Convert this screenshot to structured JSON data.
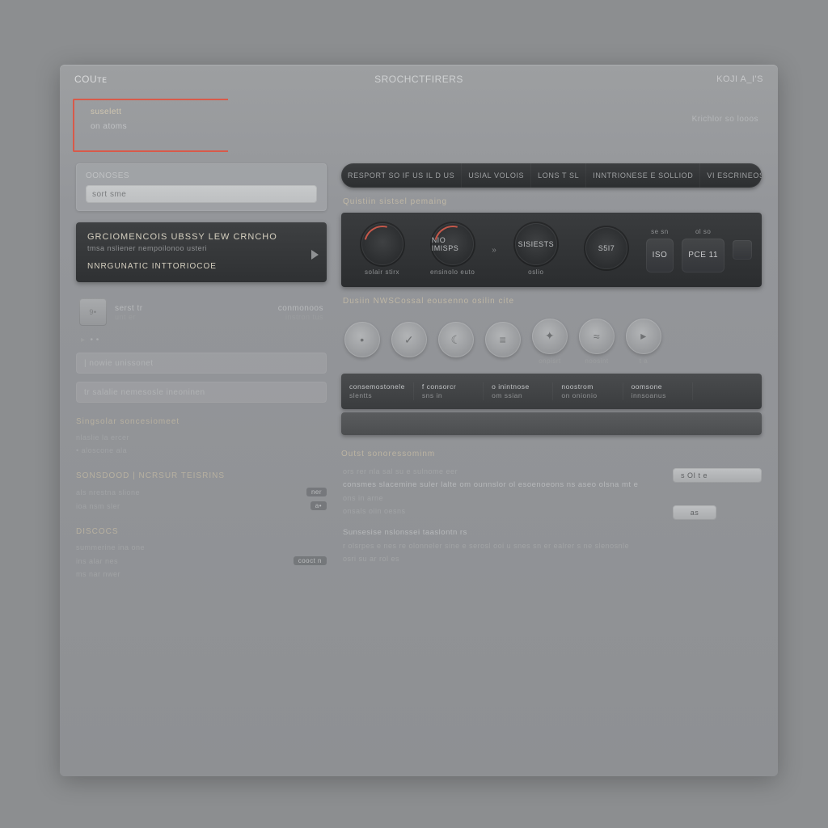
{
  "header": {
    "brand": "COUᴛᴇ",
    "title": "SROCHCTFIRERS",
    "account": "KOJI A_I'S"
  },
  "selection": {
    "line1": "suselett",
    "line2": "on atoms",
    "right_label": "Krichlor so looos"
  },
  "sidebar": {
    "card_title": "oonoses",
    "search_value": "sort sme",
    "feature": {
      "title": "GRCIOMENCOIS UBSSY LEW CRNCHO",
      "subtitle": "tmsa nsliener nempoilonoo usteri",
      "footer": "NNRGUNATIC INTTORIOCOE"
    },
    "items": [
      {
        "id": "a",
        "label": "serst tr",
        "sub": "unt er",
        "thumb": "9•"
      },
      {
        "id": "b",
        "label": "conmonoos",
        "sub": "instron tus",
        "thumb": ""
      }
    ],
    "arrow_marker": "• •",
    "row1": "| nowie unissonet",
    "row2": "tr salalie nemesosle ineoninen",
    "sections": [
      {
        "heading": "Singsolar soncesiomeet",
        "rows": [
          {
            "l": "nlaslie la ercer",
            "r": ""
          },
          {
            "l": "• aloscone ala",
            "r": ""
          }
        ]
      },
      {
        "heading": "SONSDOOD | NCRSUR TEISRINS",
        "rows": [
          {
            "l": "als nrestna slione",
            "r": "ner"
          },
          {
            "l": "ioa nsm sler",
            "r": "a•"
          }
        ]
      },
      {
        "heading": "DISCOCS",
        "rows": [
          {
            "l": "summerine ina one",
            "r": ""
          },
          {
            "l": "ins alar nes",
            "r": "cooct n"
          },
          {
            "l": "ms nar  nwer",
            "r": ""
          }
        ]
      }
    ]
  },
  "main": {
    "tabs": [
      "RESPORT SO  IF US IL D US",
      "USIAL  VOLOIS",
      "LONS T SL",
      "INNTRIONESE  E SOLLIOD",
      "VI ESCRINEOS"
    ],
    "dials_title": "Quistiin sistsel pemaing",
    "dials": [
      {
        "value": "",
        "caption": "solair stirx",
        "accent": true
      },
      {
        "value": "NIO IMISPS",
        "caption": "ensinolo euto",
        "accent": true
      },
      {
        "value": "SISIESTS",
        "caption": "oslio",
        "accent": false
      },
      {
        "value": "S5I7",
        "caption": "",
        "accent": false
      }
    ],
    "dial_pills": [
      {
        "top": "se sn",
        "value": "ISO"
      },
      {
        "top": "ol so",
        "value": "PCE 11"
      }
    ],
    "circles_title": "Dusiin NWSCossal eousenno osilin cite",
    "circles": [
      "•",
      "✓",
      "☾",
      "≡",
      "✦",
      "≈",
      "▸"
    ],
    "circle_labels": [
      "",
      "",
      "",
      "",
      "onpisrt",
      "noosint",
      "t a"
    ],
    "table_head": [
      {
        "t": "consemostonele",
        "s": "slentts"
      },
      {
        "t": "f consorcr",
        "s": "sns in"
      },
      {
        "t": "o inintnose",
        "s": "om ssian"
      },
      {
        "t": "noostrom",
        "s": "on onionio"
      },
      {
        "t": "oomsone",
        "s": "innsoanus"
      },
      {
        "t": "",
        "s": ""
      }
    ],
    "details_title": "Outst sonoressominm",
    "detail_lines": [
      "ors rer nla sal su e sulnome eer",
      "consmes slacemine suler lalte om ounnslor ol esoenoeons ns aseo olsna mt e",
      "ons in arne",
      "onsals oiin oesns",
      "Sunsesise nslonssei taaslontn rs",
      "r olsrpes e nes re olonneler sine e serosl ooi u snes sn er ealrer s ne slenosnle",
      "osri su ar rol es"
    ],
    "detail_btn_top": "s OI t e",
    "detail_btn_small": "as"
  },
  "colors": {
    "accent": "#d85a4a"
  }
}
